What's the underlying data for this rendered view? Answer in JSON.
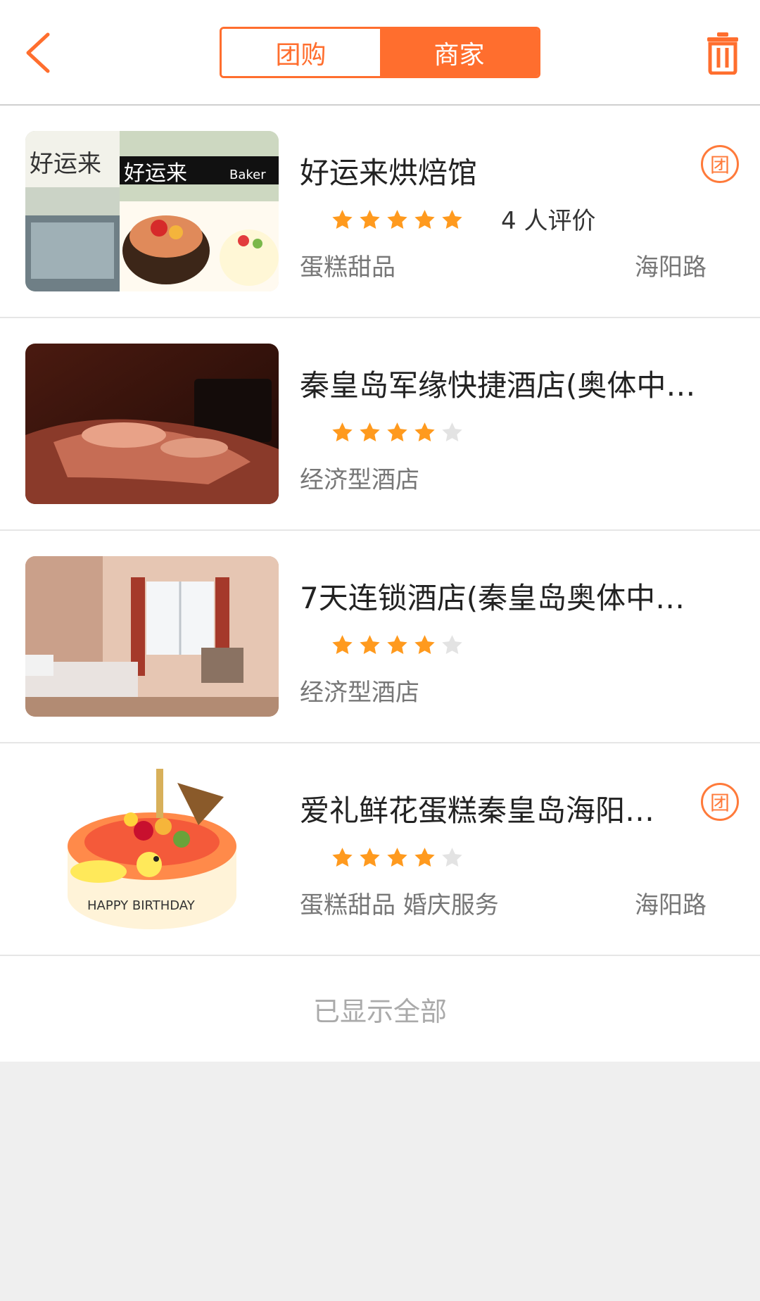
{
  "header": {
    "tabs": [
      {
        "label": "团购",
        "active": false
      },
      {
        "label": "商家",
        "active": true
      }
    ],
    "accent_color": "#ff6e2e"
  },
  "merchants": [
    {
      "title": "好运来烘焙馆",
      "rating": 5,
      "review_text": "4 人评价",
      "category": "蛋糕甜品",
      "location": "海阳路",
      "badge": "团",
      "image": "bakery-storefront-and-cakes"
    },
    {
      "title": "秦皇岛军缘快捷酒店(奥体中…",
      "rating": 4,
      "review_text": "",
      "category": "经济型酒店",
      "location": "",
      "badge": "",
      "image": "hotel-room-bed"
    },
    {
      "title": "7天连锁酒店(秦皇岛奥体中…",
      "rating": 4,
      "review_text": "",
      "category": "经济型酒店",
      "location": "",
      "badge": "",
      "image": "hotel-room-window"
    },
    {
      "title": "爱礼鲜花蛋糕秦皇岛海阳…",
      "rating": 4,
      "review_text": "",
      "category": "蛋糕甜品 婚庆服务",
      "location": "海阳路",
      "badge": "团",
      "image": "birthday-cake"
    }
  ],
  "footer_text": "已显示全部"
}
